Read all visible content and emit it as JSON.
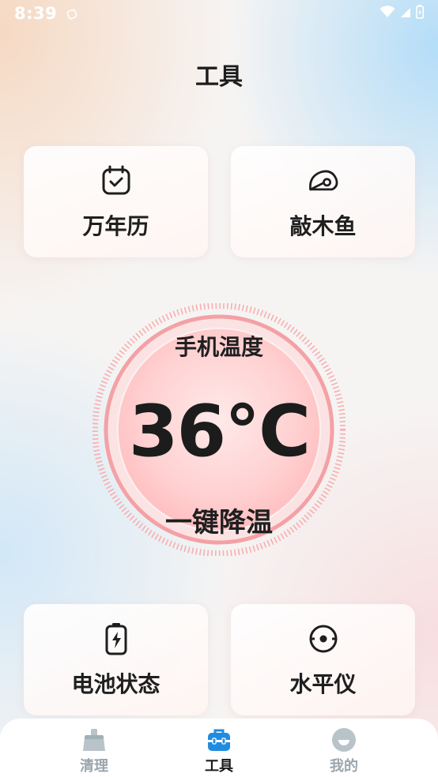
{
  "status_bar": {
    "time": "8:39"
  },
  "page": {
    "title": "工具"
  },
  "tools_top": [
    {
      "label": "万年历",
      "icon": "calendar-icon"
    },
    {
      "label": "敲木鱼",
      "icon": "wooden-fish-icon"
    }
  ],
  "temperature": {
    "title": "手机温度",
    "value": "36℃",
    "action": "一键降温"
  },
  "tools_bottom": [
    {
      "label": "电池状态",
      "icon": "battery-icon"
    },
    {
      "label": "水平仪",
      "icon": "level-icon"
    }
  ],
  "tabbar": {
    "tabs": [
      {
        "label": "清理",
        "icon": "broom-icon",
        "active": false
      },
      {
        "label": "工具",
        "icon": "toolbox-icon",
        "active": true
      },
      {
        "label": "我的",
        "icon": "profile-icon",
        "active": false
      }
    ]
  },
  "colors": {
    "gauge_red": "#f5a3a6",
    "accent_blue": "#1f8ce0",
    "tab_inactive": "#9aa6ad"
  }
}
